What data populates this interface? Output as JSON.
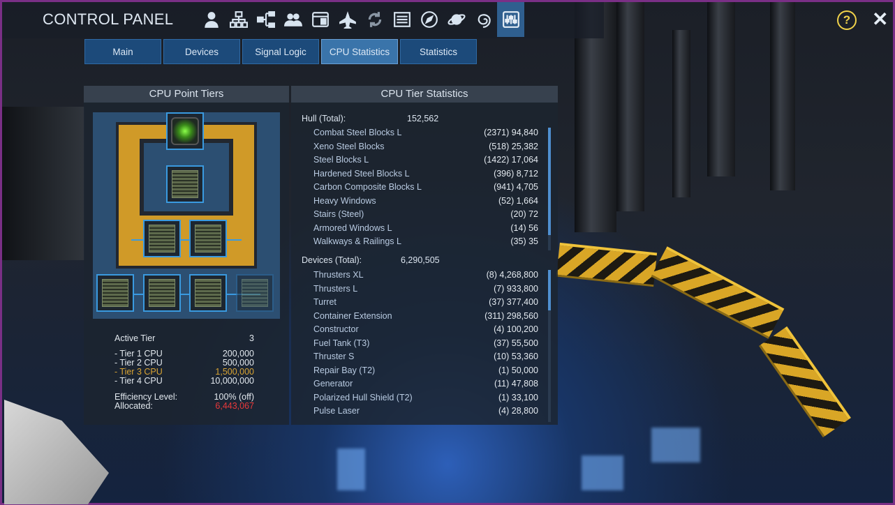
{
  "header": {
    "title": "CONTROL PANEL",
    "icons": [
      "player-icon",
      "network-icon",
      "hierarchy-icon",
      "group-icon",
      "window-icon",
      "ship-icon",
      "recycle-icon",
      "list-icon",
      "compass-icon",
      "planet-icon",
      "galaxy-icon",
      "control-sliders-icon"
    ],
    "active_icon": "control-sliders-icon",
    "help_label": "?",
    "close_label": "✕"
  },
  "tabs": [
    {
      "label": "Main",
      "active": false
    },
    {
      "label": "Devices",
      "active": false
    },
    {
      "label": "Signal Logic",
      "active": false
    },
    {
      "label": "CPU Statistics",
      "active": true
    },
    {
      "label": "Statistics",
      "active": false
    }
  ],
  "left_panel": {
    "title": "CPU Point Tiers",
    "active_tier_label": "Active Tier",
    "active_tier_value": "3",
    "tiers": [
      {
        "label": "- Tier 1 CPU",
        "value": "200,000",
        "highlight": false
      },
      {
        "label": "- Tier 2 CPU",
        "value": "500,000",
        "highlight": false
      },
      {
        "label": "- Tier 3 CPU",
        "value": "1,500,000",
        "highlight": true
      },
      {
        "label": "- Tier 4 CPU",
        "value": "10,000,000",
        "highlight": false
      }
    ],
    "efficiency_label": "Efficiency Level:",
    "efficiency_value": "100% (off)",
    "allocated_label": "Allocated:",
    "allocated_value": "6,443,067"
  },
  "right_panel": {
    "title": "CPU Tier Statistics",
    "hull": {
      "label": "Hull (Total):",
      "total": "152,562",
      "items": [
        {
          "name": "Combat Steel Blocks L",
          "value": "(2371) 94,840"
        },
        {
          "name": "Xeno Steel Blocks",
          "value": "(518) 25,382"
        },
        {
          "name": "Steel Blocks L",
          "value": "(1422) 17,064"
        },
        {
          "name": "Hardened Steel Blocks L",
          "value": "(396) 8,712"
        },
        {
          "name": "Carbon Composite Blocks L",
          "value": "(941) 4,705"
        },
        {
          "name": "Heavy Windows",
          "value": "(52) 1,664"
        },
        {
          "name": "Stairs (Steel)",
          "value": "(20) 72"
        },
        {
          "name": "Armored Windows L",
          "value": "(14) 56"
        },
        {
          "name": "Walkways & Railings L",
          "value": "(35) 35"
        }
      ]
    },
    "devices": {
      "label": "Devices (Total):",
      "total": "6,290,505",
      "items": [
        {
          "name": "Thrusters XL",
          "value": "(8) 4,268,800"
        },
        {
          "name": "Thrusters L",
          "value": "(7) 933,800"
        },
        {
          "name": "Turret",
          "value": "(37) 377,400"
        },
        {
          "name": "Container Extension",
          "value": "(311) 298,560"
        },
        {
          "name": "Constructor",
          "value": "(4) 100,200"
        },
        {
          "name": "Fuel Tank (T3)",
          "value": "(37) 55,500"
        },
        {
          "name": "Thruster S",
          "value": "(10) 53,360"
        },
        {
          "name": "Repair Bay (T2)",
          "value": "(1) 50,000"
        },
        {
          "name": "Generator",
          "value": "(11) 47,808"
        },
        {
          "name": "Polarized Hull Shield (T2)",
          "value": "(1) 33,100"
        },
        {
          "name": "Pulse Laser",
          "value": "(4) 28,800"
        }
      ]
    }
  },
  "colors": {
    "accent": "#3a9ae0",
    "gold": "#d09a28",
    "highlight": "#d9a433",
    "alert": "#e8383a"
  }
}
